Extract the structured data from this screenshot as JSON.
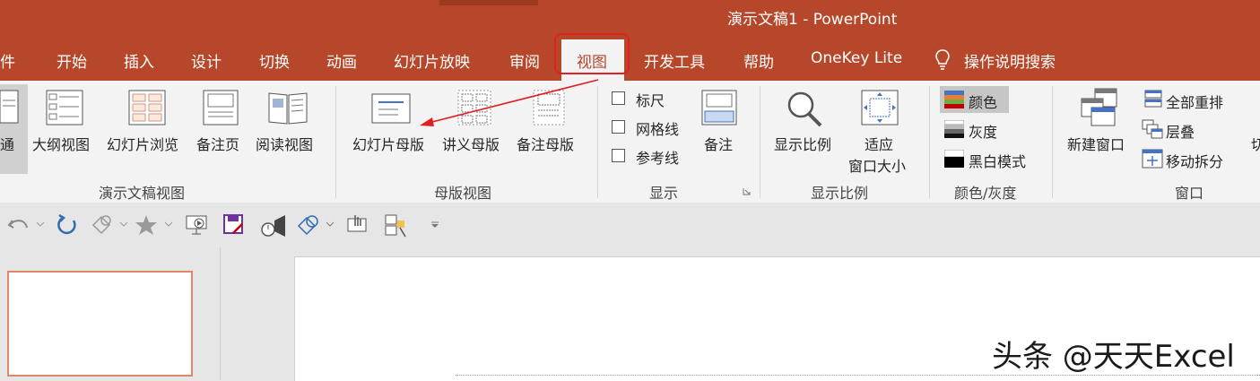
{
  "window": {
    "title": "演示文稿1  -  PowerPoint"
  },
  "tabs": {
    "file": "件",
    "home": "开始",
    "insert": "插入",
    "design": "设计",
    "transitions": "切换",
    "animations": "动画",
    "slideshow": "幻灯片放映",
    "review": "审阅",
    "view": "视图",
    "developer": "开发工具",
    "help": "帮助",
    "onekey": "OneKey Lite",
    "tellme": "操作说明搜索"
  },
  "ribbon": {
    "presentation_views": {
      "group_label": "演示文稿视图",
      "normal": "通",
      "outline": "大纲视图",
      "slide_sorter": "幻灯片浏览",
      "notes_page": "备注页",
      "reading": "阅读视图"
    },
    "master_views": {
      "group_label": "母版视图",
      "slide_master": "幻灯片母版",
      "handout_master": "讲义母版",
      "notes_master": "备注母版"
    },
    "show": {
      "group_label": "显示",
      "ruler": "标尺",
      "gridlines": "网格线",
      "guides": "参考线",
      "notes": "备注",
      "ruler_checked": false,
      "gridlines_checked": false,
      "guides_checked": false
    },
    "zoom": {
      "group_label": "显示比例",
      "zoom": "显示比例",
      "fit_line1": "适应",
      "fit_line2": "窗口大小"
    },
    "color_gray": {
      "group_label": "颜色/灰度",
      "color": "颜色",
      "grayscale": "灰度",
      "bw": "黑白模式",
      "selected": "颜色"
    },
    "window": {
      "group_label": "窗口",
      "new_window": "新建窗口",
      "arrange_all": "全部重排",
      "cascade": "层叠",
      "move_split": "移动拆分",
      "switch": "切"
    }
  },
  "watermark": "头条 @天天Excel",
  "colors": {
    "accent": "#b7472a",
    "highlight": "#e02020",
    "thumb_border": "#e0876a"
  }
}
